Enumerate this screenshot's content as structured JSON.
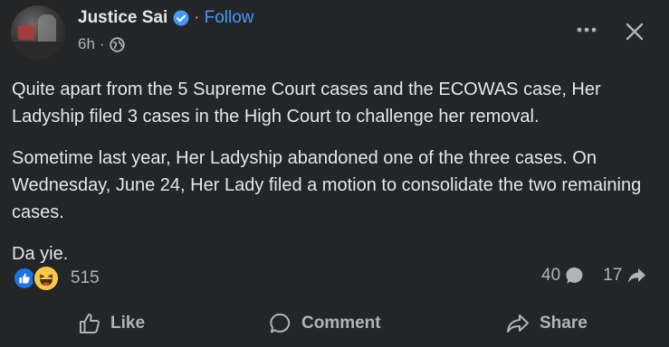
{
  "header": {
    "author": "Justice Sai",
    "separator": "·",
    "follow_label": "Follow",
    "timestamp": "6h",
    "meta_separator": "·",
    "audience_icon": "globe-icon",
    "more_icon": "more-horizontal-icon",
    "close_icon": "close-icon"
  },
  "body": {
    "paragraphs": [
      "Quite apart from the 5 Supreme Court cases and the ECOWAS case, Her Ladyship filed 3 cases in the High Court to challenge her removal.",
      "Sometime last year, Her Ladyship abandoned one of the three cases. On Wednesday, June 24, Her Lady filed a motion to consolidate the two remaining cases.",
      "Da yie."
    ]
  },
  "stats": {
    "reaction_icons": [
      "like-reaction-icon",
      "haha-reaction-icon"
    ],
    "reaction_count": "515",
    "comment_count": "40",
    "share_count": "17"
  },
  "actions": {
    "like_label": "Like",
    "comment_label": "Comment",
    "share_label": "Share"
  },
  "colors": {
    "background": "#242526",
    "text_primary": "#e4e6eb",
    "text_secondary": "#b0b3b8",
    "accent": "#4599ff",
    "like_blue": "#1b74e4",
    "haha_yellow": "#f7c949"
  }
}
